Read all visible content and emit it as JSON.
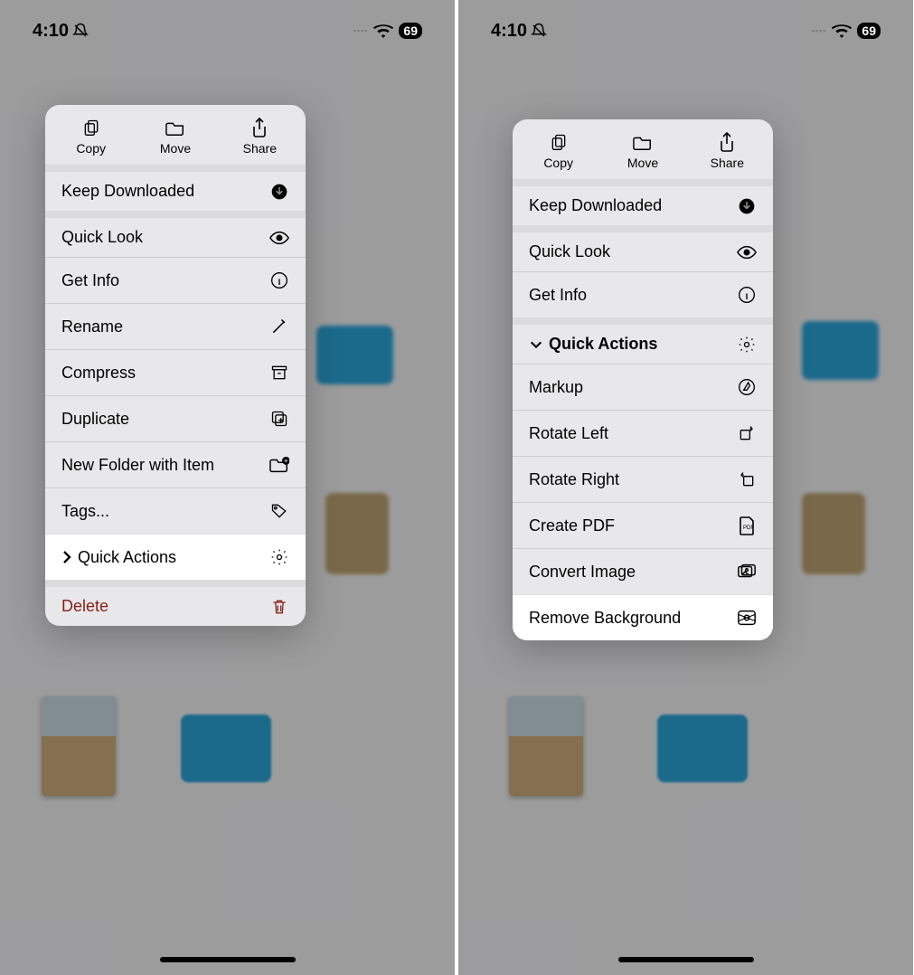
{
  "status": {
    "time": "4:10",
    "battery": "69"
  },
  "menu1": {
    "top": {
      "copy": "Copy",
      "move": "Move",
      "share": "Share"
    },
    "items": {
      "keep": "Keep Downloaded",
      "look": "Quick Look",
      "info": "Get Info",
      "rename": "Rename",
      "compress": "Compress",
      "duplicate": "Duplicate",
      "newfolder": "New Folder with Item",
      "tags": "Tags...",
      "quick": "Quick Actions",
      "delete": "Delete"
    }
  },
  "menu2": {
    "top": {
      "copy": "Copy",
      "move": "Move",
      "share": "Share"
    },
    "items": {
      "keep": "Keep Downloaded",
      "look": "Quick Look",
      "info": "Get Info",
      "quick": "Quick Actions",
      "markup": "Markup",
      "rotleft": "Rotate Left",
      "rotright": "Rotate Right",
      "pdf": "Create PDF",
      "convert": "Convert Image",
      "removebg": "Remove Background"
    }
  }
}
